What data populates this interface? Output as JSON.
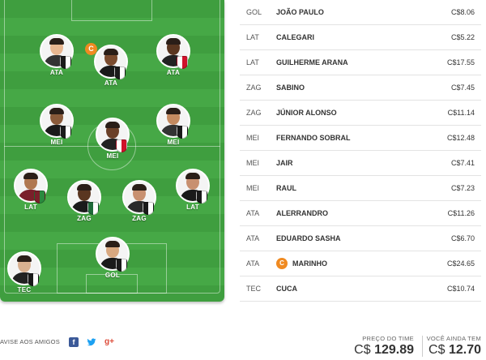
{
  "field": {
    "players": [
      {
        "pos": "ATA",
        "skin": "#e8b690",
        "shirt": "#333333",
        "badge": "#1a1a1a",
        "badge2": "#ffffff"
      },
      {
        "pos": "ATA",
        "skin": "#7a4b2e",
        "shirt": "#1a1a1a",
        "badge": "#1a1a1a",
        "badge2": "#ffffff",
        "captain": "C"
      },
      {
        "pos": "ATA",
        "skin": "#5a3620",
        "shirt": "#222222",
        "badge": "#ffffff",
        "badge2": "#d0112b"
      },
      {
        "pos": "MEI",
        "skin": "#8a5a3a",
        "shirt": "#1a1a1a",
        "badge": "#1a1a1a",
        "badge2": "#ffffff"
      },
      {
        "pos": "MEI",
        "skin": "#6a4028",
        "shirt": "#222222",
        "badge": "#ffffff",
        "badge2": "#d0112b"
      },
      {
        "pos": "MEI",
        "skin": "#c48a60",
        "shirt": "#333333",
        "badge": "#1a1a1a",
        "badge2": "#ffffff"
      },
      {
        "pos": "LAT",
        "skin": "#b07850",
        "shirt": "#7a1f2a",
        "badge": "#7a1f2a",
        "badge2": "#2b8a3e"
      },
      {
        "pos": "ZAG",
        "skin": "#5a3620",
        "shirt": "#1a1a1a",
        "badge": "#1f6b3a",
        "badge2": "#ffffff"
      },
      {
        "pos": "ZAG",
        "skin": "#c89070",
        "shirt": "#2a2a2a",
        "badge": "#1a1a1a",
        "badge2": "#ffffff"
      },
      {
        "pos": "LAT",
        "skin": "#c89070",
        "shirt": "#1a1a1a",
        "badge": "#1a1a1a",
        "badge2": "#ffffff"
      },
      {
        "pos": "GOL",
        "skin": "#d8a880",
        "shirt": "#1a1a1a",
        "badge": "#1a1a1a",
        "badge2": "#ffffff"
      },
      {
        "pos": "TEC",
        "skin": "#d8b090",
        "shirt": "#222222",
        "badge": "#1a1a1a",
        "badge2": "#ffffff"
      }
    ]
  },
  "lineup": [
    {
      "pos": "GOL",
      "name": "JOÃO PAULO",
      "price": "C$8.06"
    },
    {
      "pos": "LAT",
      "name": "CALEGARI",
      "price": "C$5.22"
    },
    {
      "pos": "LAT",
      "name": "GUILHERME ARANA",
      "price": "C$17.55"
    },
    {
      "pos": "ZAG",
      "name": "SABINO",
      "price": "C$7.45"
    },
    {
      "pos": "ZAG",
      "name": "JÚNIOR ALONSO",
      "price": "C$11.14"
    },
    {
      "pos": "MEI",
      "name": "FERNANDO SOBRAL",
      "price": "C$12.48"
    },
    {
      "pos": "MEI",
      "name": "JAIR",
      "price": "C$7.41"
    },
    {
      "pos": "MEI",
      "name": "RAUL",
      "price": "C$7.23"
    },
    {
      "pos": "ATA",
      "name": "ALERRANDRO",
      "price": "C$11.26"
    },
    {
      "pos": "ATA",
      "name": "EDUARDO SASHA",
      "price": "C$6.70"
    },
    {
      "pos": "ATA",
      "name": "MARINHO",
      "price": "C$24.65",
      "captain": "C"
    },
    {
      "pos": "TEC",
      "name": "CUCA",
      "price": "C$10.74"
    }
  ],
  "footer": {
    "share_label": "AVISE AOS AMIGOS",
    "icons": {
      "facebook": "f",
      "twitter": "🐦",
      "googleplus": "g+"
    },
    "team_price_label": "PREÇO DO TIME",
    "team_price_currency": "C$",
    "team_price_value": "129.89",
    "remaining_label": "VOCÊ AINDA TEM",
    "remaining_currency": "C$",
    "remaining_value": "12.70"
  },
  "colors": {
    "captain": "#f08a21",
    "field_dark": "#3f9e3f",
    "field_light": "#46a846"
  }
}
